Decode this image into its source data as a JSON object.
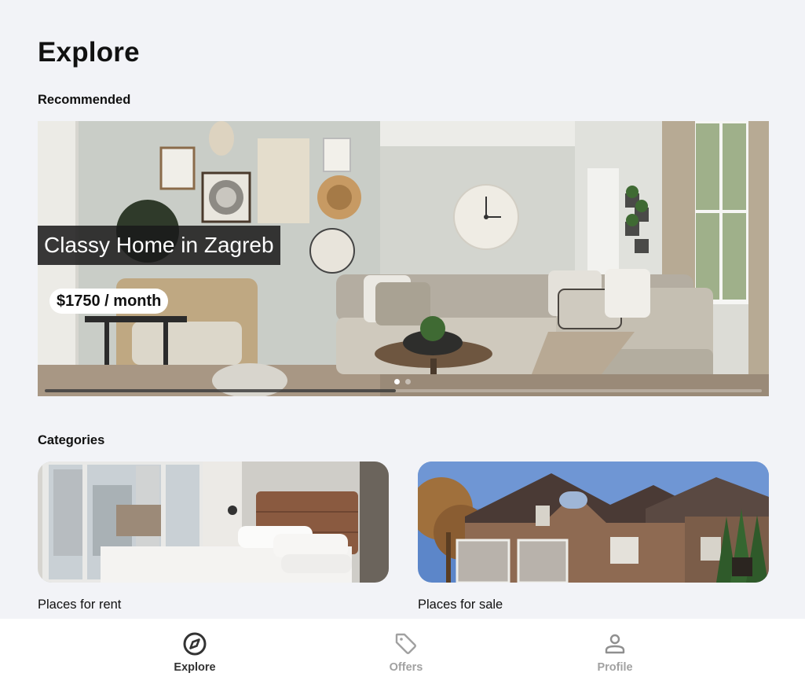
{
  "header": {
    "title": "Explore"
  },
  "recommended": {
    "label": "Recommended",
    "listing": {
      "title": "Classy Home in Zagreb",
      "price": "$1750 / month"
    },
    "carousel": {
      "active_index": 0,
      "dot_count": 2,
      "progress": 0.49
    }
  },
  "categories": {
    "label": "Categories",
    "items": [
      {
        "label": "Places for rent"
      },
      {
        "label": "Places for sale"
      }
    ]
  },
  "bottom_nav": {
    "items": [
      {
        "label": "Explore",
        "icon": "compass-icon",
        "active": true
      },
      {
        "label": "Offers",
        "icon": "tag-icon",
        "active": false
      },
      {
        "label": "Profile",
        "icon": "person-icon",
        "active": false
      }
    ]
  },
  "colors": {
    "background": "#f2f3f7",
    "active_nav": "#333333",
    "inactive_nav": "#a1a1a1"
  }
}
